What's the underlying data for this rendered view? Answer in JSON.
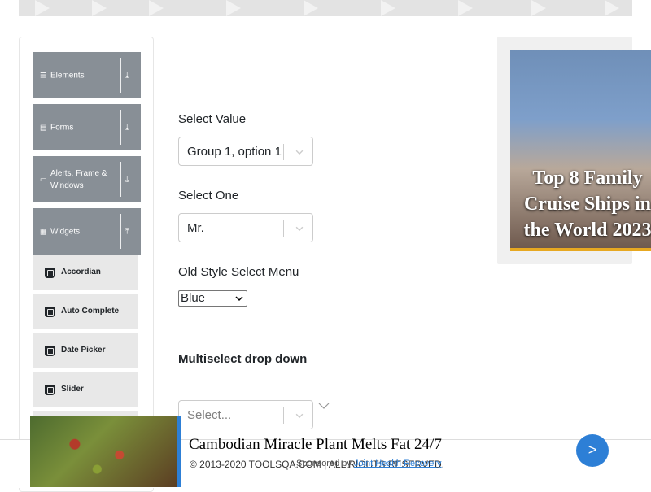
{
  "sidebar": {
    "groups": [
      {
        "label": "Elements",
        "icon": "list-icon",
        "arrow": "⤓"
      },
      {
        "label": "Forms",
        "icon": "form-icon",
        "arrow": "⤓"
      },
      {
        "label": "Alerts, Frame & Windows",
        "icon": "window-icon",
        "arrow": "⤓"
      },
      {
        "label": "Widgets",
        "icon": "grid-icon",
        "arrow": "⤒"
      }
    ],
    "items": [
      {
        "label": "Accordian",
        "icon": "html5-icon"
      },
      {
        "label": "Auto Complete",
        "icon": "html5-icon"
      },
      {
        "label": "Date Picker",
        "icon": "html5-icon"
      },
      {
        "label": "Slider",
        "icon": "html5-icon"
      }
    ]
  },
  "main": {
    "select_value": {
      "label": "Select Value",
      "value": "Group 1, option 1"
    },
    "select_one": {
      "label": "Select One",
      "value": "Mr."
    },
    "old_style": {
      "label": "Old Style Select Menu",
      "value": "Blue"
    },
    "multiselect": {
      "label": "Multiselect drop down",
      "placeholder": "Select..."
    }
  },
  "ad": {
    "title": "Top 8 Family Cruise Ships in the World 2023"
  },
  "bottom": {
    "headline": "Cambodian Miracle Plant Melts Fat 24/7",
    "copyright": "© 2013-2020 TOOLSQA.COM | ALL RIGHTS RESERVED.",
    "sponsored_prefix": "Sponsored by",
    "sponsor": "Joint Health Recovery",
    "next_label": ">"
  }
}
